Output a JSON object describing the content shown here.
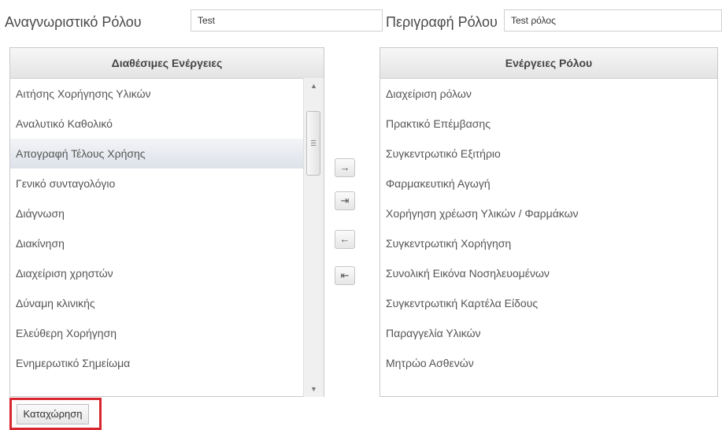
{
  "role_id": {
    "label": "Αναγνωριστικό Ρόλου",
    "value": "Test"
  },
  "role_desc": {
    "label": "Περιγραφή Ρόλου",
    "value": "Test ρόλος"
  },
  "available": {
    "header": "Διαθέσιμες Ενέργειες",
    "items": [
      "Αιτήσης Χορήγησης Υλικών",
      "Αναλυτικό Καθολικό",
      "Απογραφή Τέλους Χρήσης",
      "Γενικό συνταγολόγιο",
      "Διάγνωση",
      "Διακίνηση",
      "Διαχείριση χρηστών",
      "Δύναμη κλινικής",
      "Ελεύθερη Χορήγηση",
      "Ενημερωτικό Σημείωμα"
    ],
    "selected_index": 2
  },
  "assigned": {
    "header": "Ενέργειες Ρόλου",
    "items": [
      "Διαχείριση ρόλων",
      "Πρακτικό Επέμβασης",
      "Συγκεντρωτικό Εξιτήριο",
      "Φαρμακευτική Αγωγή",
      "Χορήγηση χρέωση Υλικών / Φαρμάκων",
      "Συγκεντρωτική Χορήγηση",
      "Συνολική Εικόνα Νοσηλευομένων",
      "Συγκεντρωτική Καρτέλα Είδους",
      "Παραγγελία Υλικών",
      "Μητρώο Ασθενών"
    ]
  },
  "move_buttons": [
    "→",
    "⇥",
    "←",
    "⇤"
  ],
  "submit_label": "Καταχώρηση",
  "colors": {
    "highlight_border": "#d8262e"
  }
}
